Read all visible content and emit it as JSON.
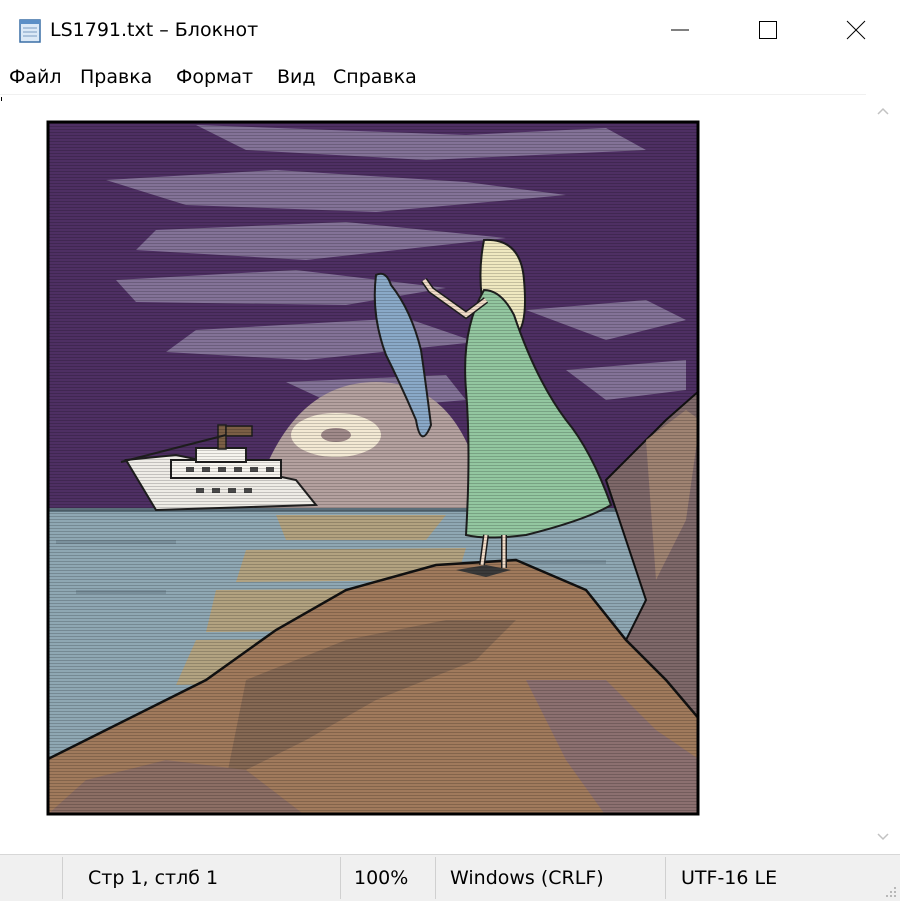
{
  "window": {
    "title": "LS1791.txt – Блокнот",
    "icon": "notepad-icon",
    "controls": [
      "minimize-icon",
      "maximize-icon",
      "close-icon"
    ]
  },
  "menu": {
    "items": [
      "Файл",
      "Правка",
      "Формат",
      "Вид",
      "Справка"
    ]
  },
  "editor": {
    "content": "ASCII art: woman in a green dress on a rocky shore waving a scarf at a motor yacht under a purple night sky with a setting moon"
  },
  "statusbar": {
    "position": "Стр 1, стлб 1",
    "zoom": "100%",
    "line_ending": "Windows (CRLF)",
    "encoding": "UTF-16 LE"
  },
  "colors": {
    "sky": "#4e2f63",
    "cloud": "#9a8fae",
    "sea": "#8fa7b3",
    "moon": "#b4a19f",
    "rock": "#a07a5c",
    "cliff": "#7e6869",
    "dress": "#93c7a0",
    "hair": "#efe8c0",
    "scarf": "#8aa9c8"
  }
}
